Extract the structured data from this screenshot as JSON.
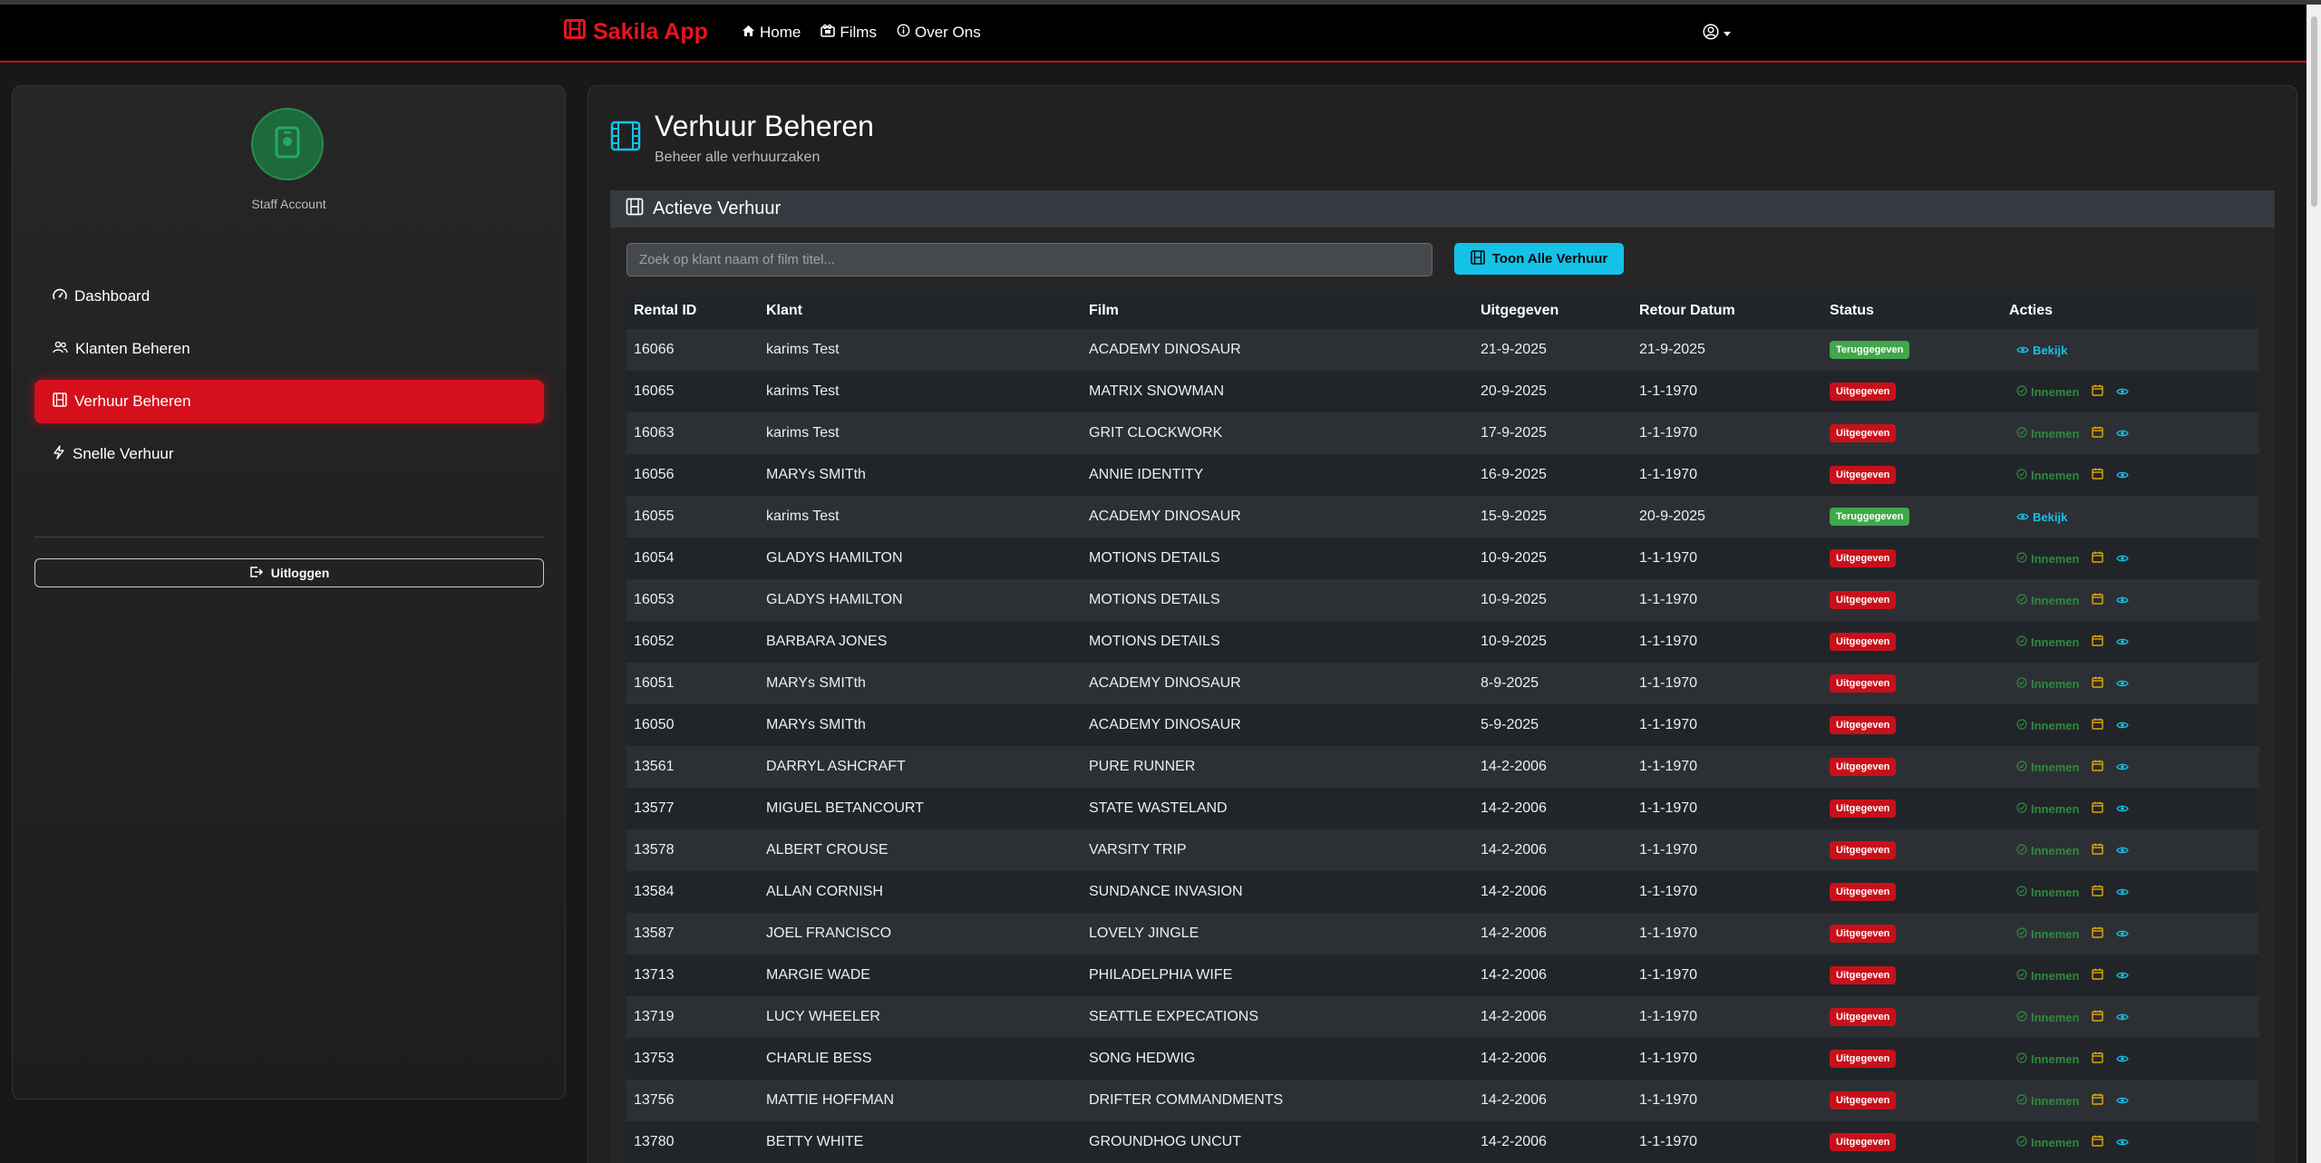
{
  "colors": {
    "accent": "#c8101a",
    "info": "#14c2e8",
    "success": "#3fa84a"
  },
  "navbar": {
    "brand": "Sakila App",
    "links": [
      {
        "label": "Home",
        "icon": "house-icon"
      },
      {
        "label": "Films",
        "icon": "film-icon"
      },
      {
        "label": "Over Ons",
        "icon": "info-icon"
      }
    ],
    "user_icon": "user-circle-icon"
  },
  "sidebar": {
    "account_label": "Staff Account",
    "items": [
      {
        "label": "Dashboard",
        "icon": "speedometer-icon",
        "active": false
      },
      {
        "label": "Klanten Beheren",
        "icon": "people-icon",
        "active": false
      },
      {
        "label": "Verhuur Beheren",
        "icon": "film-icon",
        "active": true
      },
      {
        "label": "Snelle Verhuur",
        "icon": "lightning-icon",
        "active": false
      }
    ],
    "logout_label": "Uitloggen"
  },
  "main": {
    "title": "Verhuur Beheren",
    "subtitle": "Beheer alle verhuurzaken",
    "card_title": "Actieve Verhuur",
    "search_placeholder": "Zoek op klant naam of film titel...",
    "show_all_label": "Toon Alle Verhuur",
    "columns": [
      "Rental ID",
      "Klant",
      "Film",
      "Uitgegeven",
      "Retour Datum",
      "Status",
      "Acties"
    ],
    "action_innemen": "Innemen",
    "action_bekijk": "Bekijk",
    "rows": [
      {
        "id": "16066",
        "klant": "karims Test",
        "film": "ACADEMY DINOSAUR",
        "uit": "21-9-2025",
        "retour": "21-9-2025",
        "status": "Teruggegeven",
        "returned": true
      },
      {
        "id": "16065",
        "klant": "karims Test",
        "film": "MATRIX SNOWMAN",
        "uit": "20-9-2025",
        "retour": "1-1-1970",
        "status": "Uitgegeven",
        "returned": false
      },
      {
        "id": "16063",
        "klant": "karims Test",
        "film": "GRIT CLOCKWORK",
        "uit": "17-9-2025",
        "retour": "1-1-1970",
        "status": "Uitgegeven",
        "returned": false
      },
      {
        "id": "16056",
        "klant": "MARYs SMITth",
        "film": "ANNIE IDENTITY",
        "uit": "16-9-2025",
        "retour": "1-1-1970",
        "status": "Uitgegeven",
        "returned": false
      },
      {
        "id": "16055",
        "klant": "karims Test",
        "film": "ACADEMY DINOSAUR",
        "uit": "15-9-2025",
        "retour": "20-9-2025",
        "status": "Teruggegeven",
        "returned": true
      },
      {
        "id": "16054",
        "klant": "GLADYS HAMILTON",
        "film": "MOTIONS DETAILS",
        "uit": "10-9-2025",
        "retour": "1-1-1970",
        "status": "Uitgegeven",
        "returned": false
      },
      {
        "id": "16053",
        "klant": "GLADYS HAMILTON",
        "film": "MOTIONS DETAILS",
        "uit": "10-9-2025",
        "retour": "1-1-1970",
        "status": "Uitgegeven",
        "returned": false
      },
      {
        "id": "16052",
        "klant": "BARBARA JONES",
        "film": "MOTIONS DETAILS",
        "uit": "10-9-2025",
        "retour": "1-1-1970",
        "status": "Uitgegeven",
        "returned": false
      },
      {
        "id": "16051",
        "klant": "MARYs SMITth",
        "film": "ACADEMY DINOSAUR",
        "uit": "8-9-2025",
        "retour": "1-1-1970",
        "status": "Uitgegeven",
        "returned": false
      },
      {
        "id": "16050",
        "klant": "MARYs SMITth",
        "film": "ACADEMY DINOSAUR",
        "uit": "5-9-2025",
        "retour": "1-1-1970",
        "status": "Uitgegeven",
        "returned": false
      },
      {
        "id": "13561",
        "klant": "DARRYL ASHCRAFT",
        "film": "PURE RUNNER",
        "uit": "14-2-2006",
        "retour": "1-1-1970",
        "status": "Uitgegeven",
        "returned": false
      },
      {
        "id": "13577",
        "klant": "MIGUEL BETANCOURT",
        "film": "STATE WASTELAND",
        "uit": "14-2-2006",
        "retour": "1-1-1970",
        "status": "Uitgegeven",
        "returned": false
      },
      {
        "id": "13578",
        "klant": "ALBERT CROUSE",
        "film": "VARSITY TRIP",
        "uit": "14-2-2006",
        "retour": "1-1-1970",
        "status": "Uitgegeven",
        "returned": false
      },
      {
        "id": "13584",
        "klant": "ALLAN CORNISH",
        "film": "SUNDANCE INVASION",
        "uit": "14-2-2006",
        "retour": "1-1-1970",
        "status": "Uitgegeven",
        "returned": false
      },
      {
        "id": "13587",
        "klant": "JOEL FRANCISCO",
        "film": "LOVELY JINGLE",
        "uit": "14-2-2006",
        "retour": "1-1-1970",
        "status": "Uitgegeven",
        "returned": false
      },
      {
        "id": "13713",
        "klant": "MARGIE WADE",
        "film": "PHILADELPHIA WIFE",
        "uit": "14-2-2006",
        "retour": "1-1-1970",
        "status": "Uitgegeven",
        "returned": false
      },
      {
        "id": "13719",
        "klant": "LUCY WHEELER",
        "film": "SEATTLE EXPECATIONS",
        "uit": "14-2-2006",
        "retour": "1-1-1970",
        "status": "Uitgegeven",
        "returned": false
      },
      {
        "id": "13753",
        "klant": "CHARLIE BESS",
        "film": "SONG HEDWIG",
        "uit": "14-2-2006",
        "retour": "1-1-1970",
        "status": "Uitgegeven",
        "returned": false
      },
      {
        "id": "13756",
        "klant": "MATTIE HOFFMAN",
        "film": "DRIFTER COMMANDMENTS",
        "uit": "14-2-2006",
        "retour": "1-1-1970",
        "status": "Uitgegeven",
        "returned": false
      },
      {
        "id": "13780",
        "klant": "BETTY WHITE",
        "film": "GROUNDHOG UNCUT",
        "uit": "14-2-2006",
        "retour": "1-1-1970",
        "status": "Uitgegeven",
        "returned": false
      }
    ]
  }
}
